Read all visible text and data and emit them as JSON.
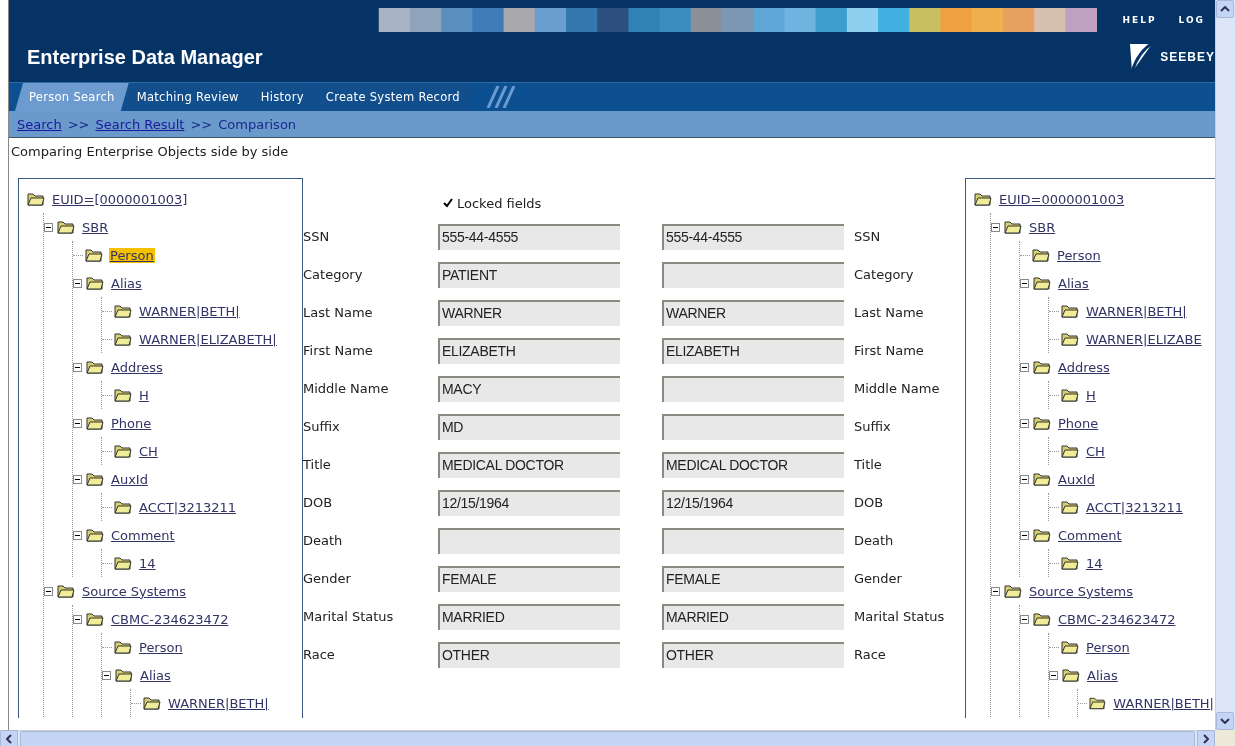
{
  "header": {
    "title": "Enterprise Data Manager",
    "links": [
      "HELP",
      "LOG"
    ],
    "logo": "SEEBEY"
  },
  "tabs": [
    {
      "label": "Person Search",
      "selected": true
    },
    {
      "label": "Matching Review",
      "selected": false
    },
    {
      "label": "History",
      "selected": false
    },
    {
      "label": "Create System Record",
      "selected": false
    }
  ],
  "breadcrumb": [
    {
      "kind": "link",
      "label": "Search"
    },
    {
      "kind": "separator",
      "label": ">>"
    },
    {
      "kind": "link",
      "label": "Search Result"
    },
    {
      "kind": "separator",
      "label": ">>"
    },
    {
      "kind": "current",
      "label": "Comparison"
    }
  ],
  "description": "Comparing Enterprise Objects side by side",
  "left_tree": [
    {
      "label": "EUID=[0000001003]",
      "selected": false,
      "children": [
        {
          "label": "SBR",
          "selected": false,
          "expanded": true,
          "children": [
            {
              "label": "Person",
              "selected": true
            },
            {
              "label": "Alias",
              "selected": false,
              "expanded": true,
              "children": [
                {
                  "label": "WARNER|BETH|",
                  "selected": false
                },
                {
                  "label": "WARNER|ELIZABETH|",
                  "selected": false
                }
              ]
            },
            {
              "label": "Address",
              "selected": false,
              "expanded": true,
              "children": [
                {
                  "label": "H",
                  "selected": false
                }
              ]
            },
            {
              "label": "Phone",
              "selected": false,
              "expanded": true,
              "children": [
                {
                  "label": "CH",
                  "selected": false
                }
              ]
            },
            {
              "label": "AuxId",
              "selected": false,
              "expanded": true,
              "children": [
                {
                  "label": "ACCT|3213211",
                  "selected": false
                }
              ]
            },
            {
              "label": "Comment",
              "selected": false,
              "expanded": true,
              "children": [
                {
                  "label": "14",
                  "selected": false
                }
              ]
            }
          ]
        },
        {
          "label": "Source Systems",
          "selected": false,
          "expanded": true,
          "children": [
            {
              "label": "CBMC-234623472",
              "selected": false,
              "expanded": true,
              "children": [
                {
                  "label": "Person",
                  "selected": false
                },
                {
                  "label": "Alias",
                  "selected": false,
                  "expanded": true,
                  "children": [
                    {
                      "label": "WARNER|BETH|",
                      "selected": false
                    }
                  ]
                }
              ]
            }
          ]
        }
      ]
    }
  ],
  "locked_fields": {
    "label": "Locked fields",
    "checked": true
  },
  "fields": [
    {
      "label": "SSN",
      "left_value": "555-44-4555",
      "right_value": "555-44-4555",
      "right_label": "SSN"
    },
    {
      "label": "Category",
      "left_value": "PATIENT",
      "right_label": "Category"
    },
    {
      "label": "Last Name",
      "left_value": "WARNER",
      "right_value": "WARNER",
      "right_label": "Last Name"
    },
    {
      "label": "First Name",
      "left_value": "ELIZABETH",
      "right_value": "ELIZABETH",
      "right_label": "First Name"
    },
    {
      "label": "Middle Name",
      "left_value": "MACY",
      "right_label": "Middle Name"
    },
    {
      "label": "Suffix",
      "left_value": "MD",
      "right_label": "Suffix"
    },
    {
      "label": "Title",
      "left_value": "MEDICAL DOCTOR",
      "right_value": "MEDICAL DOCTOR",
      "right_label": "Title"
    },
    {
      "label": "DOB",
      "left_value": "12/15/1964",
      "right_value": "12/15/1964",
      "right_label": "DOB"
    },
    {
      "label": "Death",
      "right_label": "Death"
    },
    {
      "label": "Gender",
      "left_value": "FEMALE",
      "right_value": "FEMALE",
      "right_label": "Gender"
    },
    {
      "label": "Marital Status",
      "left_value": "MARRIED",
      "right_value": "MARRIED",
      "right_label": "Marital Status"
    },
    {
      "label": "Race",
      "left_value": "OTHER",
      "right_value": "OTHER",
      "right_label": "Race"
    }
  ],
  "right_tree": [
    {
      "label": "EUID=0000001003",
      "selected": false,
      "children": [
        {
          "label": "SBR",
          "selected": false,
          "expanded": true,
          "children": [
            {
              "label": "Person",
              "selected": false
            },
            {
              "label": "Alias",
              "selected": false,
              "expanded": true,
              "children": [
                {
                  "label": "WARNER|BETH|",
                  "selected": false
                },
                {
                  "label": "WARNER|ELIZABE",
                  "selected": false
                }
              ]
            },
            {
              "label": "Address",
              "selected": false,
              "expanded": true,
              "children": [
                {
                  "label": "H",
                  "selected": false
                }
              ]
            },
            {
              "label": "Phone",
              "selected": false,
              "expanded": true,
              "children": [
                {
                  "label": "CH",
                  "selected": false
                }
              ]
            },
            {
              "label": "AuxId",
              "selected": false,
              "expanded": true,
              "children": [
                {
                  "label": "ACCT|3213211",
                  "selected": false
                }
              ]
            },
            {
              "label": "Comment",
              "selected": false,
              "expanded": true,
              "children": [
                {
                  "label": "14",
                  "selected": false
                }
              ]
            }
          ]
        },
        {
          "label": "Source Systems",
          "selected": false,
          "expanded": true,
          "children": [
            {
              "label": "CBMC-234623472",
              "selected": false,
              "expanded": true,
              "children": [
                {
                  "label": "Person",
                  "selected": false
                },
                {
                  "label": "Alias",
                  "selected": false,
                  "expanded": true,
                  "children": [
                    {
                      "label": "WARNER|BETH|",
                      "selected": false
                    }
                  ]
                }
              ]
            }
          ]
        }
      ]
    }
  ]
}
